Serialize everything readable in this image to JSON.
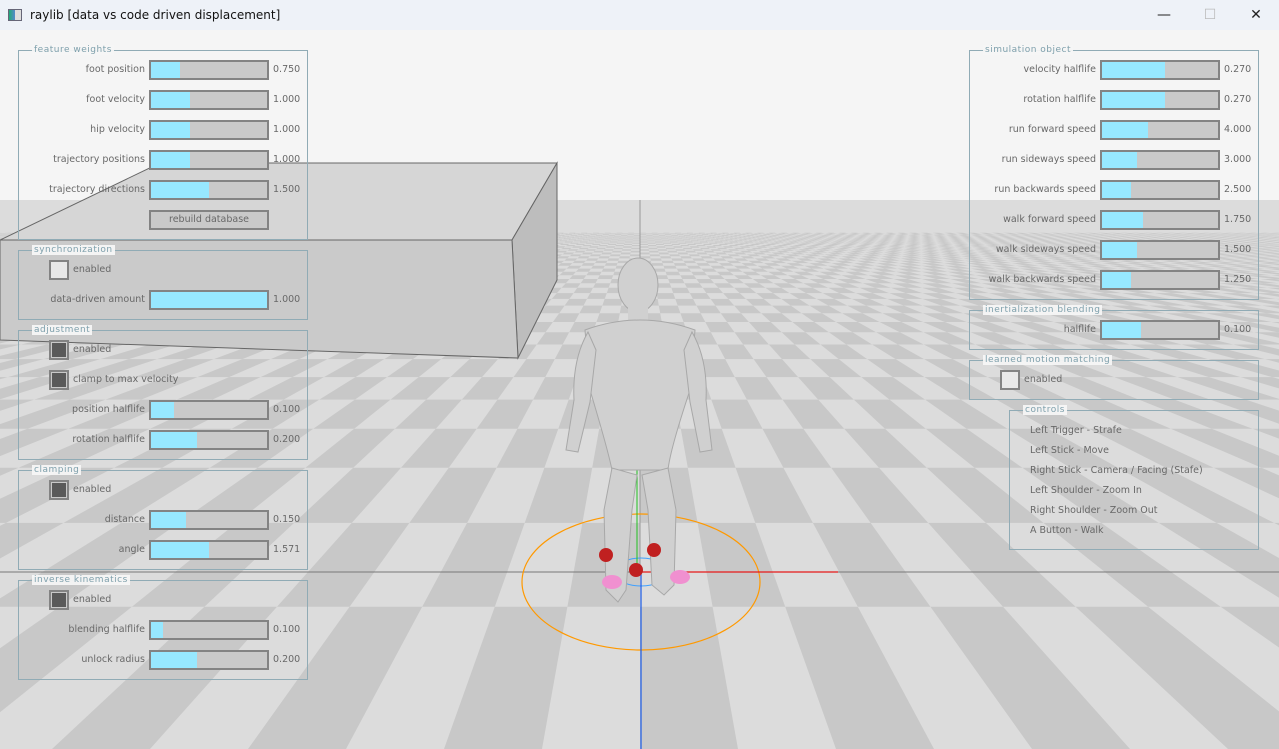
{
  "window": {
    "title": "raylib [data vs code driven displacement]",
    "minimize": "—",
    "maximize": "☐",
    "close": "✕"
  },
  "left_panels": [
    {
      "title": "feature weights",
      "rows": [
        {
          "type": "slider",
          "label": "foot position",
          "value": "0.750",
          "fill": 0.25
        },
        {
          "type": "slider",
          "label": "foot velocity",
          "value": "1.000",
          "fill": 0.333
        },
        {
          "type": "slider",
          "label": "hip velocity",
          "value": "1.000",
          "fill": 0.333
        },
        {
          "type": "slider",
          "label": "trajectory positions",
          "value": "1.000",
          "fill": 0.333
        },
        {
          "type": "slider",
          "label": "trajectory directions",
          "value": "1.500",
          "fill": 0.5
        },
        {
          "type": "button",
          "label": "rebuild database"
        }
      ]
    },
    {
      "title": "synchronization",
      "rows": [
        {
          "type": "checkbox",
          "label": "enabled",
          "checked": false
        },
        {
          "type": "slider",
          "label": "data-driven amount",
          "value": "1.000",
          "fill": 1.0
        }
      ]
    },
    {
      "title": "adjustment",
      "rows": [
        {
          "type": "checkbox",
          "label": "enabled",
          "checked": true
        },
        {
          "type": "checkbox",
          "label": "clamp to max velocity",
          "checked": true
        },
        {
          "type": "slider",
          "label": "position halflife",
          "value": "0.100",
          "fill": 0.2
        },
        {
          "type": "slider",
          "label": "rotation halflife",
          "value": "0.200",
          "fill": 0.4
        }
      ]
    },
    {
      "title": "clamping",
      "rows": [
        {
          "type": "checkbox",
          "label": "enabled",
          "checked": true
        },
        {
          "type": "slider",
          "label": "distance",
          "value": "0.150",
          "fill": 0.3
        },
        {
          "type": "slider",
          "label": "angle",
          "value": "1.571",
          "fill": 0.5
        }
      ]
    },
    {
      "title": "inverse kinematics",
      "rows": [
        {
          "type": "checkbox",
          "label": "enabled",
          "checked": true
        },
        {
          "type": "slider",
          "label": "blending halflife",
          "value": "0.100",
          "fill": 0.1
        },
        {
          "type": "slider",
          "label": "unlock radius",
          "value": "0.200",
          "fill": 0.4
        }
      ]
    }
  ],
  "right_panels": [
    {
      "title": "simulation object",
      "rows": [
        {
          "type": "slider",
          "label": "velocity halflife",
          "value": "0.270",
          "fill": 0.54
        },
        {
          "type": "slider",
          "label": "rotation halflife",
          "value": "0.270",
          "fill": 0.54
        },
        {
          "type": "slider",
          "label": "run forward speed",
          "value": "4.000",
          "fill": 0.4
        },
        {
          "type": "slider",
          "label": "run sideways speed",
          "value": "3.000",
          "fill": 0.3
        },
        {
          "type": "slider",
          "label": "run backwards speed",
          "value": "2.500",
          "fill": 0.25
        },
        {
          "type": "slider",
          "label": "walk forward speed",
          "value": "1.750",
          "fill": 0.35
        },
        {
          "type": "slider",
          "label": "walk sideways speed",
          "value": "1.500",
          "fill": 0.3
        },
        {
          "type": "slider",
          "label": "walk backwards speed",
          "value": "1.250",
          "fill": 0.25
        }
      ]
    },
    {
      "title": "inertialization blending",
      "rows": [
        {
          "type": "slider",
          "label": "halflife",
          "value": "0.100",
          "fill": 0.333
        }
      ]
    },
    {
      "title": "learned motion matching",
      "rows": [
        {
          "type": "checkbox",
          "label": "enabled",
          "checked": false
        }
      ]
    }
  ],
  "controls": {
    "title": "controls",
    "lines": [
      "Left Trigger - Strafe",
      "Left Stick - Move",
      "Right Stick - Camera / Facing (Stafe)",
      "Left Shoulder - Zoom In",
      "Right Shoulder - Zoom Out",
      "A Button - Walk"
    ]
  },
  "colors": {
    "slider_fill": "#97e8ff",
    "group_border": "#90abb5",
    "text": "#686868",
    "trajectory_circle": "#ff9900"
  }
}
